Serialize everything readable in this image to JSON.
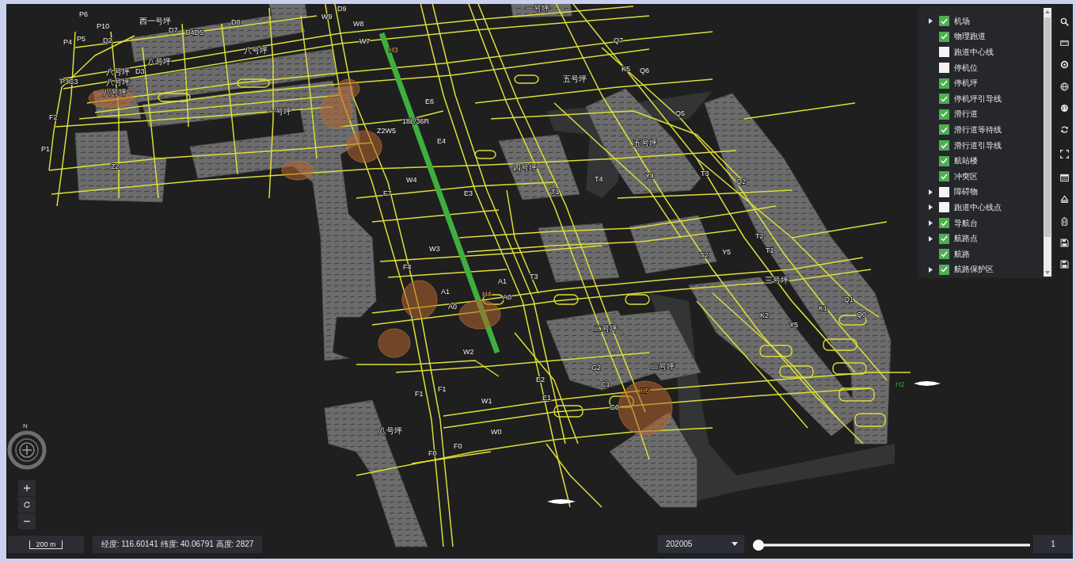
{
  "map": {
    "labels": [
      {
        "text": "P6",
        "kind": "taxiway"
      },
      {
        "text": "西一号坪",
        "kind": "apron"
      },
      {
        "text": "P10",
        "kind": "taxiway"
      },
      {
        "text": "D7",
        "kind": "taxiway"
      },
      {
        "text": "D4D5",
        "kind": "taxiway"
      },
      {
        "text": "D8",
        "kind": "taxiway"
      },
      {
        "text": "P4",
        "kind": "taxiway"
      },
      {
        "text": "P5",
        "kind": "taxiway"
      },
      {
        "text": "D2",
        "kind": "taxiway"
      },
      {
        "text": "八号坪",
        "kind": "apron"
      },
      {
        "text": "八号坪",
        "kind": "apron"
      },
      {
        "text": "八号坪",
        "kind": "apron"
      },
      {
        "text": "八号坪",
        "kind": "apron"
      },
      {
        "text": "八号坪",
        "kind": "apron"
      },
      {
        "text": "D3",
        "kind": "taxiway"
      },
      {
        "text": "P3C3",
        "kind": "taxiway"
      },
      {
        "text": "F2",
        "kind": "taxiway"
      },
      {
        "text": "P1",
        "kind": "taxiway"
      },
      {
        "text": "Z2",
        "kind": "taxiway"
      },
      {
        "text": "一号坪",
        "kind": "apron"
      },
      {
        "text": "D9",
        "kind": "taxiway"
      },
      {
        "text": "W9",
        "kind": "taxiway"
      },
      {
        "text": "W8",
        "kind": "taxiway"
      },
      {
        "text": "W7",
        "kind": "taxiway"
      },
      {
        "text": "Z2W5",
        "kind": "taxiway"
      },
      {
        "text": "18L/36R",
        "kind": "taxiway"
      },
      {
        "text": "E6",
        "kind": "taxiway"
      },
      {
        "text": "E4",
        "kind": "taxiway"
      },
      {
        "text": "W4",
        "kind": "taxiway"
      },
      {
        "text": "F7",
        "kind": "taxiway"
      },
      {
        "text": "E3",
        "kind": "taxiway"
      },
      {
        "text": "W3",
        "kind": "taxiway"
      },
      {
        "text": "F4",
        "kind": "taxiway"
      },
      {
        "text": "A1",
        "kind": "taxiway"
      },
      {
        "text": "A1",
        "kind": "taxiway"
      },
      {
        "text": "A0",
        "kind": "taxiway"
      },
      {
        "text": "A0",
        "kind": "taxiway"
      },
      {
        "text": "W2",
        "kind": "taxiway"
      },
      {
        "text": "F1",
        "kind": "taxiway"
      },
      {
        "text": "F1",
        "kind": "taxiway"
      },
      {
        "text": "W1",
        "kind": "taxiway"
      },
      {
        "text": "W0",
        "kind": "taxiway"
      },
      {
        "text": "F0",
        "kind": "taxiway"
      },
      {
        "text": "F0",
        "kind": "taxiway"
      },
      {
        "text": "E2",
        "kind": "taxiway"
      },
      {
        "text": "E1",
        "kind": "taxiway"
      },
      {
        "text": "T3",
        "kind": "taxiway"
      },
      {
        "text": "T1",
        "kind": "taxiway"
      },
      {
        "text": "T4",
        "kind": "taxiway"
      },
      {
        "text": "五号坪",
        "kind": "apron"
      },
      {
        "text": "五号坪",
        "kind": "apron"
      },
      {
        "text": "Y4",
        "kind": "taxiway"
      },
      {
        "text": "T3",
        "kind": "taxiway"
      },
      {
        "text": "Q2",
        "kind": "taxiway"
      },
      {
        "text": "T2",
        "kind": "taxiway"
      },
      {
        "text": "T2",
        "kind": "taxiway"
      },
      {
        "text": "Y5",
        "kind": "taxiway"
      },
      {
        "text": "T1",
        "kind": "taxiway"
      },
      {
        "text": "Q1",
        "kind": "taxiway"
      },
      {
        "text": "Q0",
        "kind": "taxiway"
      },
      {
        "text": "K2",
        "kind": "taxiway"
      },
      {
        "text": "Y5",
        "kind": "taxiway"
      },
      {
        "text": "K1",
        "kind": "taxiway"
      },
      {
        "text": "二号坪",
        "kind": "apron"
      },
      {
        "text": "G2",
        "kind": "taxiway"
      },
      {
        "text": "C1",
        "kind": "taxiway"
      },
      {
        "text": "G0",
        "kind": "taxiway"
      },
      {
        "text": "二号坪",
        "kind": "apron"
      },
      {
        "text": "三号坪",
        "kind": "apron"
      },
      {
        "text": "Q7",
        "kind": "taxiway"
      },
      {
        "text": "K5",
        "kind": "taxiway"
      },
      {
        "text": "Q6",
        "kind": "taxiway"
      },
      {
        "text": "Q5",
        "kind": "taxiway"
      },
      {
        "text": "一号坪",
        "kind": "apron"
      },
      {
        "text": "四号坪",
        "kind": "apron"
      },
      {
        "text": "H3",
        "kind": "hotspot"
      },
      {
        "text": "H4",
        "kind": "hotspot"
      },
      {
        "text": "H5",
        "kind": "hotspot"
      },
      {
        "text": "H2",
        "kind": "aircraft"
      },
      {
        "text": "八号坪",
        "kind": "apron"
      }
    ]
  },
  "layer_panel": {
    "layers": [
      {
        "label": "机场",
        "checked": true,
        "expandable": true
      },
      {
        "label": "物理跑道",
        "checked": true,
        "expandable": false
      },
      {
        "label": "跑道中心线",
        "checked": false,
        "expandable": false
      },
      {
        "label": "停机位",
        "checked": false,
        "expandable": false
      },
      {
        "label": "停机坪",
        "checked": true,
        "expandable": false
      },
      {
        "label": "停机坪引导线",
        "checked": true,
        "expandable": false
      },
      {
        "label": "滑行道",
        "checked": true,
        "expandable": false
      },
      {
        "label": "滑行道等待线",
        "checked": true,
        "expandable": false
      },
      {
        "label": "滑行道引导线",
        "checked": true,
        "expandable": false
      },
      {
        "label": "航站楼",
        "checked": true,
        "expandable": false
      },
      {
        "label": "冲突区",
        "checked": true,
        "expandable": false
      },
      {
        "label": "障碍物",
        "checked": false,
        "expandable": true
      },
      {
        "label": "跑道中心线点",
        "checked": false,
        "expandable": true
      },
      {
        "label": "导航台",
        "checked": true,
        "expandable": true
      },
      {
        "label": "航路点",
        "checked": true,
        "expandable": true
      },
      {
        "label": "航路",
        "checked": true,
        "expandable": false
      },
      {
        "label": "航路保护区",
        "checked": true,
        "expandable": true
      }
    ]
  },
  "compass": {
    "label": "N"
  },
  "scale_bar": {
    "label": "200 m"
  },
  "coordinates": "经度: 116.60141 纬度: 40.06791 高度: 2827",
  "time_control": {
    "date": "202005",
    "level": 0,
    "value": "1"
  }
}
